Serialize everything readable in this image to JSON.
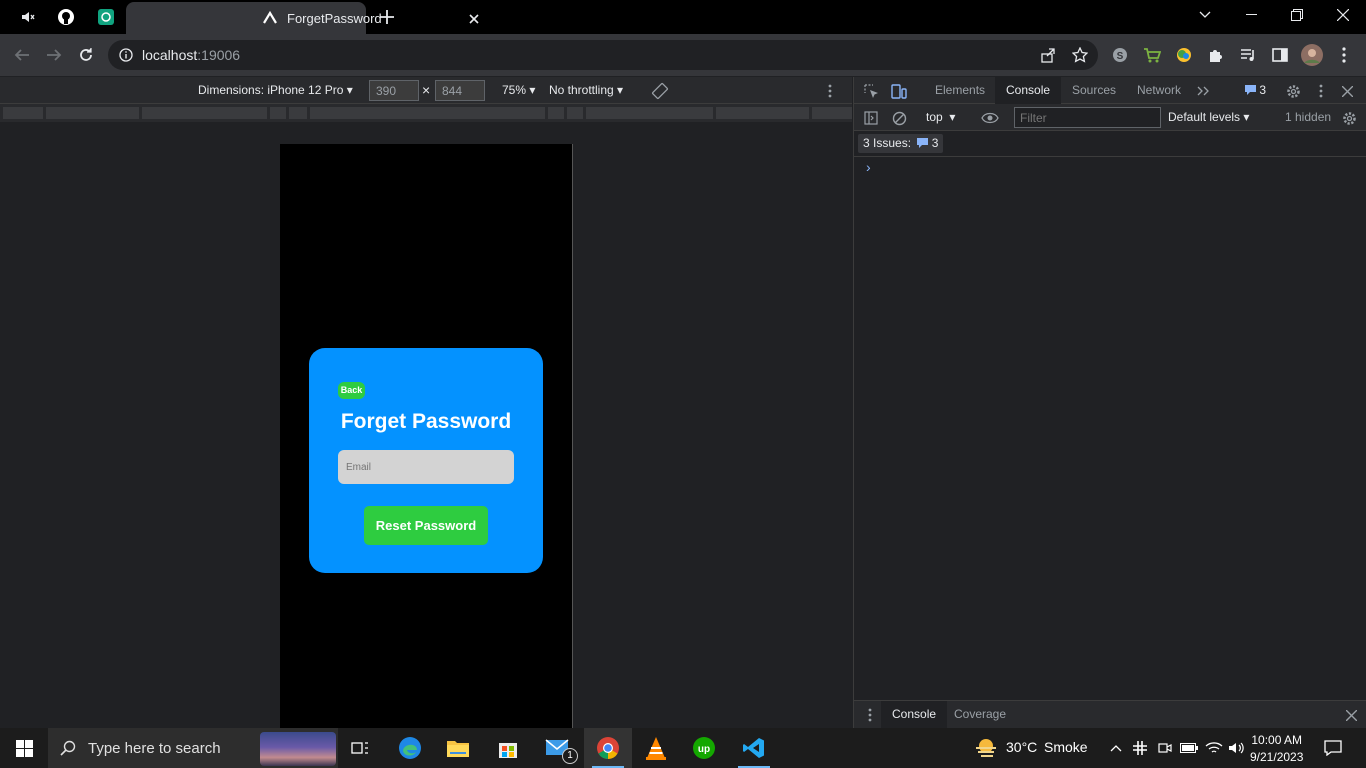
{
  "browser": {
    "tab_title": "ForgetPassword",
    "url_host": "localhost",
    "url_port": ":19006"
  },
  "device_toolbar": {
    "dimensions_label": "Dimensions: iPhone 12 Pro",
    "width": "390",
    "height": "844",
    "times": "×",
    "zoom": "75%",
    "throttling": "No throttling"
  },
  "app": {
    "back_label": "Back",
    "title": "Forget Password",
    "email_placeholder": "Email",
    "reset_label": "Reset Password",
    "card_color": "#0492ff",
    "button_color": "#2ecc40"
  },
  "devtools": {
    "tabs": [
      "Elements",
      "Console",
      "Sources",
      "Network"
    ],
    "active_tab": "Console",
    "issues_count": "3",
    "context": "top",
    "filter_placeholder": "Filter",
    "levels": "Default levels",
    "hidden": "1 hidden",
    "issues_label": "3 Issues:",
    "prompt": "›",
    "drawer_tabs": [
      "Console",
      "Coverage"
    ]
  },
  "taskbar": {
    "search_placeholder": "Type here to search",
    "weather_temp": "30°C",
    "weather_desc": "Smoke",
    "time": "10:00 AM",
    "date": "9/21/2023",
    "mail_badge": "1"
  }
}
